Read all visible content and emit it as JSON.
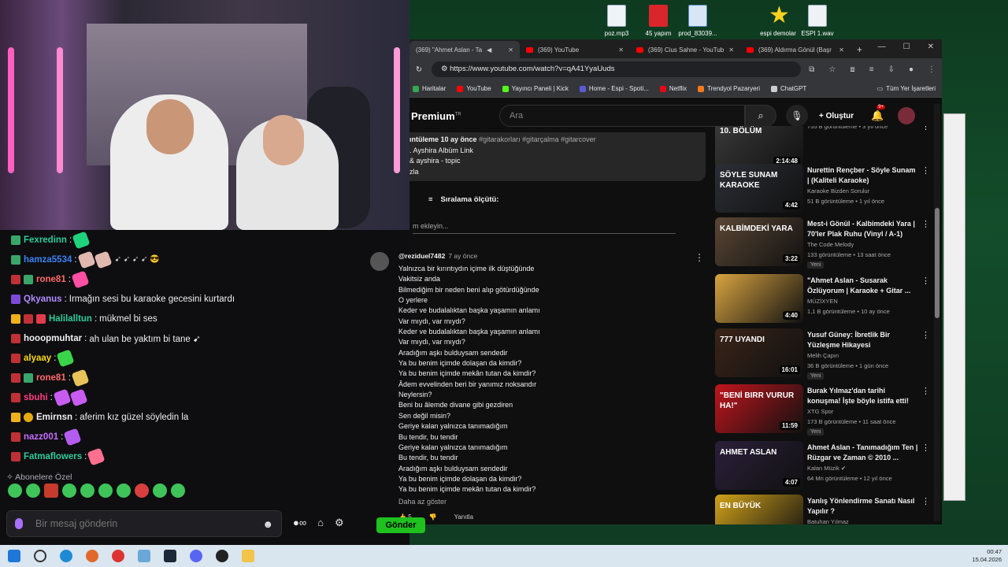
{
  "desktop": {
    "icons": [
      {
        "label": "poz.mp3",
        "type": "mp3"
      },
      {
        "label": "45 yapım",
        "type": "pdf"
      },
      {
        "label": "prod_83039...",
        "type": "doc"
      },
      {
        "label": "espi demolar",
        "type": "star"
      },
      {
        "label": "ESPI 1.wav",
        "type": "wav"
      }
    ]
  },
  "chat": {
    "messages": [
      {
        "user": "Fexredinn",
        "color": "#2ecc9a",
        "text": "",
        "badges": [
          "sub"
        ],
        "emotes": [
          "#1fd27c"
        ]
      },
      {
        "user": "hamza5534",
        "color": "#3b82f6",
        "text": "",
        "badges": [
          "sub"
        ],
        "emotes": [
          "#e0b8b0",
          "#e0b8b0"
        ],
        "tail": "➹ ➹ ➹ ➹ 😎"
      },
      {
        "user": "rone81",
        "color": "#ff6a6a",
        "text": "",
        "badges": [
          "mod",
          "sub"
        ],
        "emotes": [
          "#ff4fa3"
        ]
      },
      {
        "user": "Qkyanus",
        "color": "#b08cff",
        "text": "Irmağın sesi bu karaoke gecesini kurtardı",
        "badges": [
          "vip"
        ],
        "emotes": []
      },
      {
        "user": "Halilalltun",
        "color": "#2ecc9a",
        "text": "mükmel bi ses",
        "badges": [
          "crown",
          "mod",
          "gift"
        ],
        "emotes": []
      },
      {
        "user": "hooopmuhtar",
        "color": "#f0f0f0",
        "text": "ah ulan be yaktım bi tane ➹",
        "badges": [
          "mod"
        ],
        "emotes": []
      },
      {
        "user": "alyaay",
        "color": "#f5d90a",
        "text": "",
        "badges": [
          "mod"
        ],
        "emotes": [
          "#39d44a"
        ]
      },
      {
        "user": "rone81",
        "color": "#ff6a6a",
        "text": "",
        "badges": [
          "mod",
          "sub"
        ],
        "emotes": [
          "#e8c35a"
        ]
      },
      {
        "user": "sbuhi",
        "color": "#ff3d7f",
        "text": "",
        "badges": [
          "mod"
        ],
        "emotes": [
          "#c85cf0",
          "#c85cf0"
        ]
      },
      {
        "user": "Emirnsn",
        "color": "#f0f0f0",
        "text": "aferim kız güzel söyledin la",
        "badges": [
          "crown",
          "one"
        ],
        "emotes": []
      },
      {
        "user": "nazz001",
        "color": "#c56cff",
        "text": "",
        "badges": [
          "mod"
        ],
        "emotes": [
          "#b45cf0"
        ]
      },
      {
        "user": "Fatmaflowers",
        "color": "#2ecc9a",
        "text": "",
        "badges": [
          "mod"
        ],
        "emotes": [
          "#ff6f8f"
        ]
      }
    ],
    "subs_label": "Abonelere Özel",
    "input_placeholder": "Bir mesaj gönderin",
    "send_label": "Gönder"
  },
  "browser": {
    "tabs": [
      {
        "label": "(369) \"Ahmet Aslan - Ta",
        "active": true
      },
      {
        "label": "(369) YouTube",
        "active": false
      },
      {
        "label": "(369) Cius Sahne - YouTub",
        "active": false
      },
      {
        "label": "(369) Aldırma Gönül (Başr",
        "active": false
      }
    ],
    "url": "https://www.youtube.com/watch?v=qA41YyaUuds",
    "bookmarks": [
      {
        "label": "Haritalar",
        "color": "#34a853"
      },
      {
        "label": "YouTube",
        "color": "#ff0000"
      },
      {
        "label": "Yayıncı Paneli | Kick",
        "color": "#53fc18"
      },
      {
        "label": "Home - Espi - Spoti...",
        "color": "#5b5bd6"
      },
      {
        "label": "Netflix",
        "color": "#e50914"
      },
      {
        "label": "Trendyol Pazaryeri",
        "color": "#f27a1a"
      },
      {
        "label": "ChatGPT",
        "color": "#cccccc"
      }
    ],
    "bookmarks_right": "Tüm Yer İşaretleri"
  },
  "youtube": {
    "logo": "Premium",
    "logo_sup": "TR",
    "search_placeholder": "Ara",
    "create_label": "Oluştur",
    "notif_count": "9+",
    "desc_line1_prefix": "ıntüleme  10 ay önce",
    "desc_tags": "#gitarakorları #gitarçalma #gitarcover",
    "desc_line2": ". Ayshira Albüm Link",
    "desc_line3": "& ayshira - topic",
    "desc_line4": "zla",
    "sort_label": "Sıralama ölçütü:",
    "add_comment": "m ekleyin...",
    "comment": {
      "author": "@reziduel7482",
      "time": "7 ay önce",
      "lines": [
        "Yalnızca bir kırıntıydın içime ilk düştüğünde",
        "Vakitsiz anda",
        "Bilmediğim bir neden beni alıp götürdüğünde",
        "O yerlere",
        "Keder ve budalalıktan başka yaşamın anlamı",
        "Var mıydı, var mıydı?",
        "Keder ve budalalıktan başka yaşamın anlamı",
        "Var mıydı, var mıydı?",
        "Aradığım aşkı bulduysam sendedir",
        "Ya bu benim içimde dolaşan da kimdir?",
        "Ya bu benim içimde mekân tutan da kimdir?",
        "Âdem evvelinden beri bir yanımız noksandır",
        "Neylersin?",
        "Beni bu âlemde divane gibi gezdiren",
        "Sen değil misin?",
        "Geriye kalan yalnızca tanımadığım",
        "Bu tendir, bu tendir",
        "Geriye kalan yalnızca tanımadığım",
        "Bu tendir, bu tendir",
        "Aradığım aşkı bulduysam sendedir",
        "Ya bu benim içimde dolaşan da kimdir?",
        "Ya bu benim içimde mekân tutan da kimdir?"
      ],
      "less": "Daha az göster",
      "likes": "5",
      "reply": "Yanıtla"
    },
    "sidebar": [
      {
        "title": "",
        "channel": "",
        "meta": "755 B görüntüleme • 3 yıl önce",
        "duration": "2:14:48",
        "thumb_text": "10. BÖLÜM",
        "thumb_color": "#3a3a3a",
        "new": ""
      },
      {
        "title": "Nurettin Rençber - Söyle Sunam | (Kaliteli Karaoke)",
        "channel": "Karaoke Bizden Sorulur",
        "meta": "51 B görüntüleme • 1 yıl önce",
        "duration": "4:42",
        "thumb_text": "SÖYLE SUNAM KARAOKE",
        "thumb_color": "#2d2f36",
        "new": ""
      },
      {
        "title": "Mest-i Gönül - Kalbimdeki Yara | 70'ler Plak Ruhu (Vinyl / A-1)",
        "channel": "The Code Melody",
        "meta": "133 görüntüleme • 13 saat önce",
        "duration": "3:22",
        "thumb_text": "KALBİMDEKİ YARA",
        "thumb_color": "#5a4634",
        "new": "Yeni"
      },
      {
        "title": "\"Ahmet Aslan - Susarak Özlüyorum | Karaoke + Gitar ...",
        "channel": "MÜZİXYEN",
        "meta": "1,1 B görüntüleme • 10 ay önce",
        "duration": "4:40",
        "thumb_text": "",
        "thumb_color": "#d9a441",
        "new": ""
      },
      {
        "title": "Yusuf Güney: İbretlik Bir Yüzleşme Hikayesi",
        "channel": "Melih Çapın",
        "meta": "36 B görüntüleme • 1 gün önce",
        "duration": "16:01",
        "thumb_text": "777 UYANDI",
        "thumb_color": "#3a2418",
        "new": "Yeni"
      },
      {
        "title": "Burak Yılmaz'dan tarihi konuşma! İşte böyle istifa etti!",
        "channel": "XTG Spor",
        "meta": "173 B görüntüleme • 11 saat önce",
        "duration": "11:59",
        "thumb_text": "\"BENİ BIRR VURUR HA!\"",
        "thumb_color": "#c0151d",
        "new": "Yeni"
      },
      {
        "title": "Ahmet Aslan - Tanımadığım Ten | Rüzgar ve Zaman © 2010 ...",
        "channel": "Kalan Müzik ✔",
        "meta": "64 Mn görüntüleme • 12 yıl önce",
        "duration": "4:07",
        "thumb_text": "AHMET ASLAN",
        "thumb_color": "#2a1f3a",
        "new": ""
      },
      {
        "title": "Yanlış Yönlendirme Sanatı Nasıl Yapılır ?",
        "channel": "Batuhan Yılmaz",
        "meta": "",
        "duration": "",
        "thumb_text": "EN BÜYÜK",
        "thumb_color": "#d1a21a",
        "new": ""
      }
    ]
  },
  "taskbar": {
    "time": "00:47",
    "date": "15.04.2026"
  }
}
